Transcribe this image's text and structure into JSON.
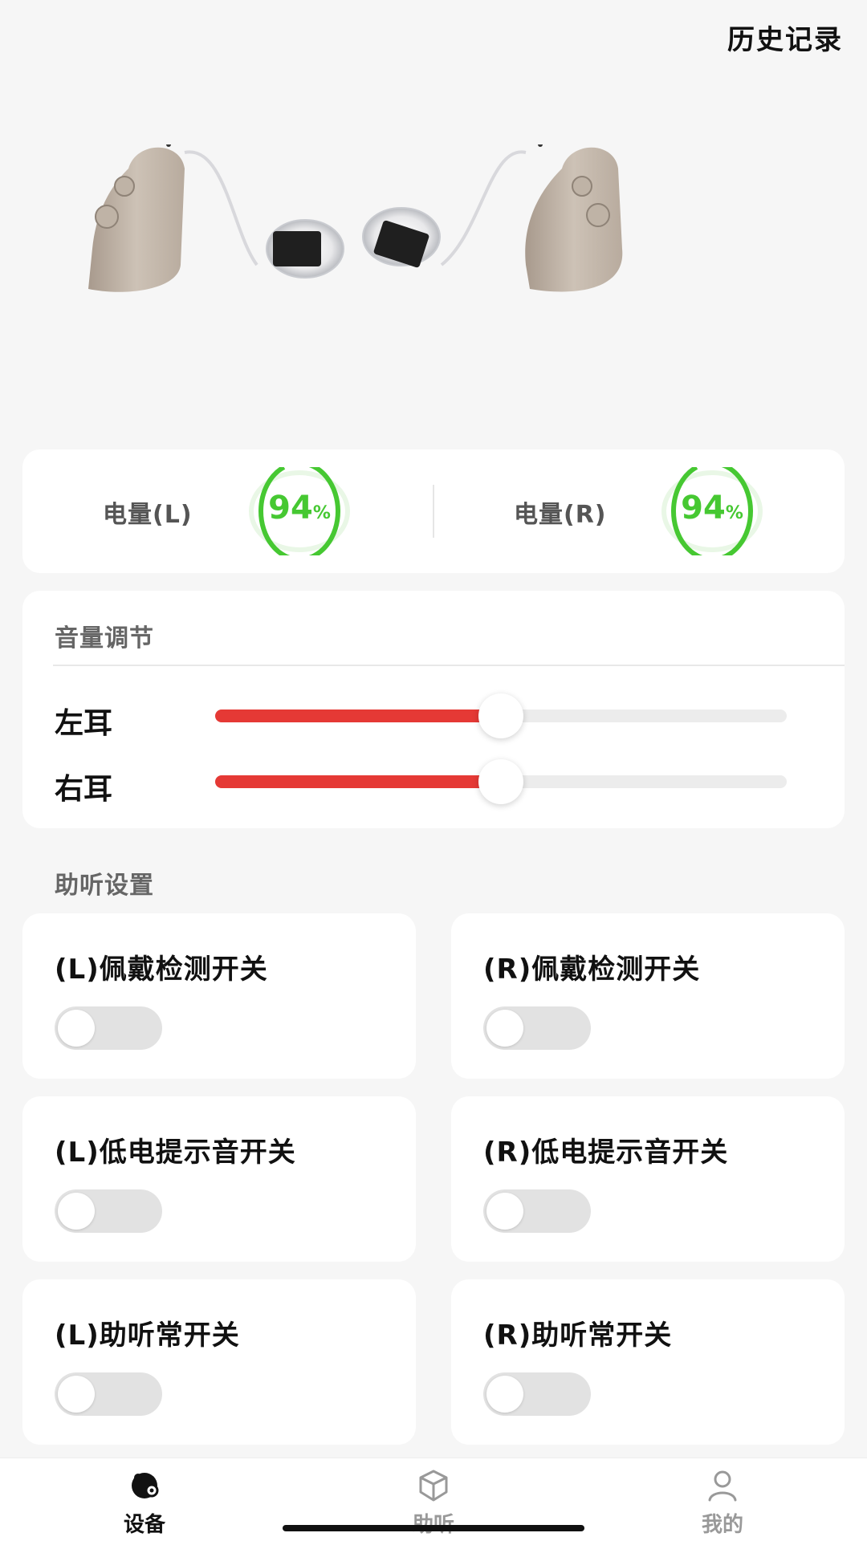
{
  "header": {
    "history_label": "历史记录"
  },
  "battery": {
    "left": {
      "label": "电量(L)",
      "value": "94",
      "unit": "%",
      "level": 0.94
    },
    "right": {
      "label": "电量(R)",
      "value": "94",
      "unit": "%",
      "level": 0.94
    },
    "accent_color": "#46c832"
  },
  "volume": {
    "title": "音量调节",
    "left": {
      "label": "左耳",
      "level": 0.5
    },
    "right": {
      "label": "右耳",
      "level": 0.5
    },
    "fill_color": "#e53935"
  },
  "settings": {
    "title": "助听设置",
    "items": [
      {
        "label": "(L)佩戴检测开关",
        "on": false
      },
      {
        "label": "(R)佩戴检测开关",
        "on": false
      },
      {
        "label": "(L)低电提示音开关",
        "on": false
      },
      {
        "label": "(R)低电提示音开关",
        "on": false
      },
      {
        "label": "(L)助听常开关",
        "on": false
      },
      {
        "label": "(R)助听常开关",
        "on": false
      }
    ]
  },
  "nav": {
    "items": [
      {
        "label": "设备",
        "icon": "device-icon",
        "active": true
      },
      {
        "label": "助听",
        "icon": "cube-icon",
        "active": false
      },
      {
        "label": "我的",
        "icon": "user-icon",
        "active": false
      }
    ]
  }
}
